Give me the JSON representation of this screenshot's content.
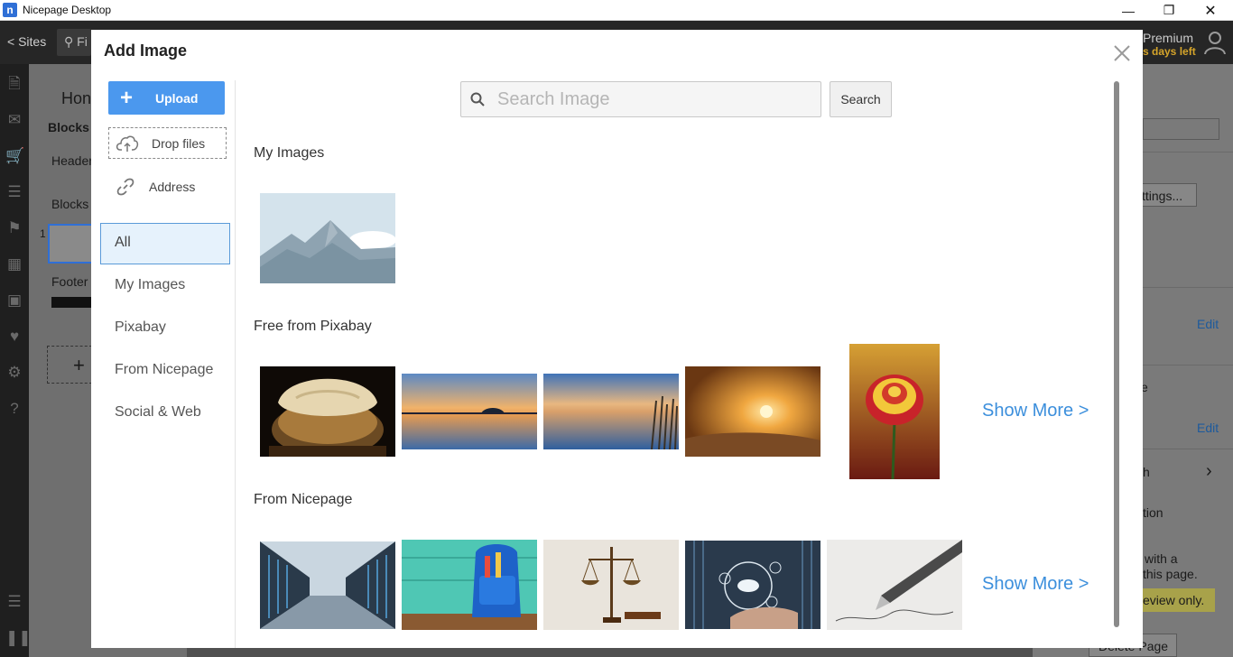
{
  "window": {
    "title": "Nicepage Desktop",
    "minimize": "—",
    "maximize": "❐",
    "close": "✕"
  },
  "app": {
    "sites_link": "< Sites",
    "find_placeholder": "Fi",
    "premium": "Premium",
    "days_left": "s days left",
    "left_panel": {
      "home": "Hon",
      "blocks_tab": "Blocks",
      "header": "Header",
      "blocks": "Blocks",
      "block_number": "1",
      "footer": "Footer",
      "add": "+"
    },
    "right_panel": {
      "settings_btn": "ttings...",
      "edit_1": "Edit",
      "label_e": "e",
      "edit_2": "Edit",
      "label_h": "h",
      "label_tion": "tion",
      "with_a": "with a",
      "this_page": "this page.",
      "review_only": "eview only.",
      "delete_page": "Delete Page"
    }
  },
  "modal": {
    "title": "Add Image",
    "upload_label": "Upload",
    "drop_files_label": "Drop files",
    "address_label": "Address",
    "categories": [
      "All",
      "My Images",
      "Pixabay",
      "From Nicepage",
      "Social & Web"
    ],
    "active_category": "All",
    "search": {
      "placeholder": "Search Image",
      "button_label": "Search"
    },
    "sections": {
      "my_images": "My Images",
      "pixabay": "Free from Pixabay",
      "nicepage": "From Nicepage"
    },
    "show_more": "Show More >",
    "images": {
      "my_images": [
        "mountain placeholder"
      ],
      "pixabay": [
        "jar of bread",
        "sunset lake island",
        "lake with reeds",
        "sun over clouds",
        "red yellow rose"
      ],
      "nicepage": [
        "server room",
        "blue backpack",
        "scales of justice",
        "business cloud tech",
        "fountain pen writing"
      ]
    }
  },
  "colors": {
    "accent": "#4b98ee",
    "link": "#3c8fdc",
    "active_bg": "#e6f2fc",
    "days_left": "#d6a52a"
  }
}
